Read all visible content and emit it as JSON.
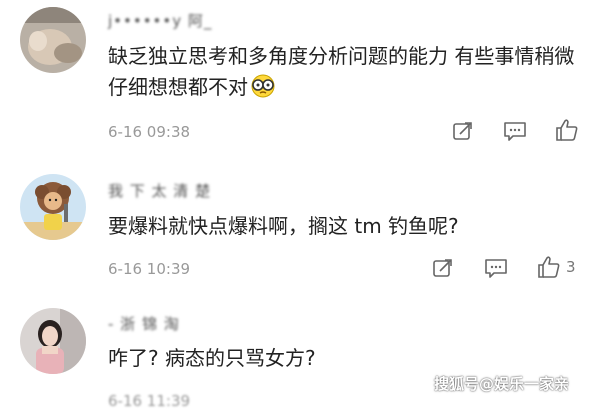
{
  "comments": [
    {
      "username": "j••••••y 阿_",
      "text": "缺乏独立思考和多角度分析问题的能力 有些事情稍微仔细想想都不对",
      "emoji": "glasses-emoji",
      "time": "6-16 09:38",
      "like_count": ""
    },
    {
      "username": "我 下 太 清 楚",
      "text": "要爆料就快点爆料啊，搁这 tm 钓鱼呢?",
      "time": "6-16 10:39",
      "like_count": "3"
    },
    {
      "username": "- 浙 锦 淘",
      "text": "咋了? 病态的只骂女方?",
      "time": "6-16 11:39"
    }
  ],
  "watermark": "搜狐号@娱乐一家亲",
  "colors": {
    "text": "#222222",
    "meta": "#999999",
    "icon": "#666666"
  }
}
